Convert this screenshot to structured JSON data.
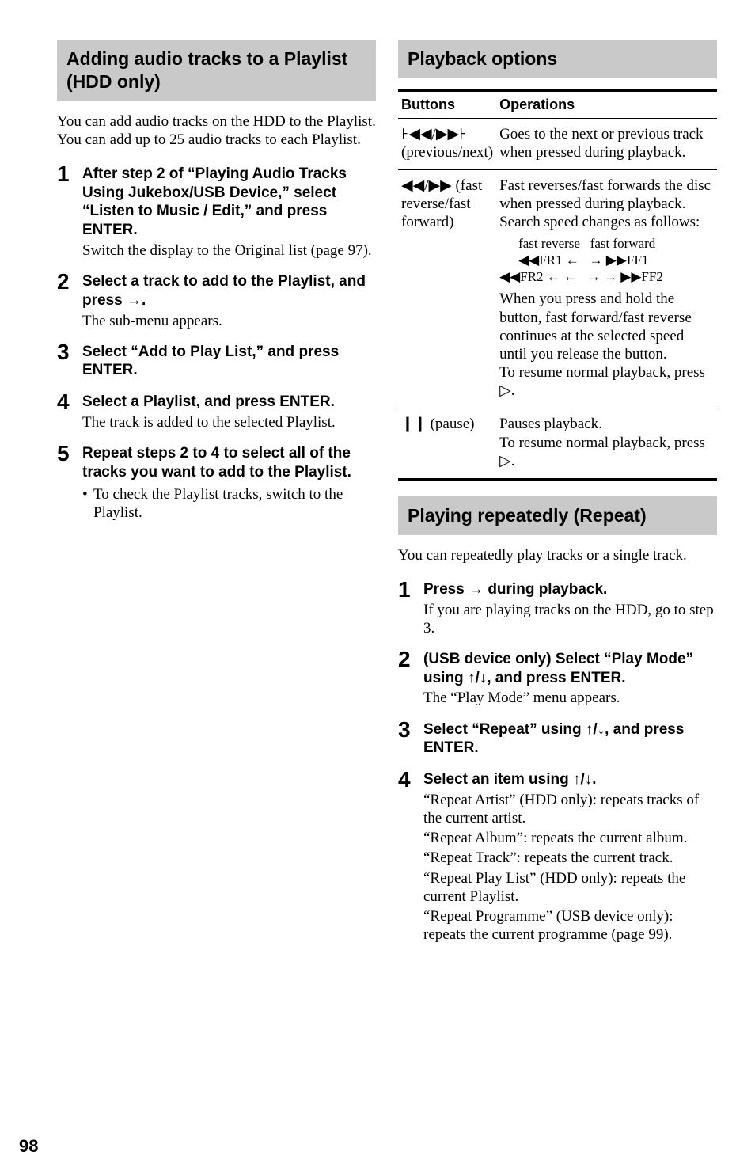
{
  "left": {
    "title": "Adding audio tracks to a Playlist (HDD only)",
    "intro": "You can add audio tracks on the HDD to the Playlist. You can add up to 25 audio tracks to each Playlist.",
    "steps": [
      {
        "num": "1",
        "head": "After step 2 of “Playing Audio Tracks Using Jukebox/USB Device,” select “Listen to Music / Edit,” and press ENTER.",
        "sub": "Switch the display to the Original list (page 97)."
      },
      {
        "num": "2",
        "head": "Select a track to add to the Playlist, and press →.",
        "sub": "The sub-menu appears."
      },
      {
        "num": "3",
        "head": "Select “Add to Play List,” and press ENTER."
      },
      {
        "num": "4",
        "head": "Select a Playlist, and press ENTER.",
        "sub": "The track is added to the selected Playlist."
      },
      {
        "num": "5",
        "head": "Repeat steps 2 to 4 to select all of the tracks you want to add to the Playlist.",
        "bullet": "To check the Playlist tracks, switch to the Playlist."
      }
    ]
  },
  "right": {
    "playback_title": "Playback options",
    "table": {
      "head_buttons": "Buttons",
      "head_ops": "Operations",
      "rows": [
        {
          "btn": "꜔◀◀/▶▶꜔ (previous/next)",
          "op": "Goes to the next or previous track when pressed during playback."
        },
        {
          "btn": "◀◀/▶▶ (fast reverse/fast forward)",
          "op_line1": "Fast reverses/fast forwards the disc when pressed during playback.",
          "op_line2": "Search speed changes as follows:",
          "speed_label": "fast reverse   fast forward",
          "speed_row1": "◀◀FR1 ←   → ▶▶FF1",
          "speed_row2": "◀◀FR2 ← ←   → → ▶▶FF2",
          "op_line3": "When you press and hold the button, fast forward/fast reverse continues at the selected speed until you release the button.",
          "op_line4": "To resume normal playback, press ▷."
        },
        {
          "btn": "❙❙ (pause)",
          "op_line1": "Pauses playback.",
          "op_line2": "To resume normal playback, press ▷."
        }
      ]
    },
    "repeat_title": "Playing repeatedly (Repeat)",
    "repeat_intro": "You can repeatedly play tracks or a single track.",
    "repeat_steps": [
      {
        "num": "1",
        "head": "Press → during playback.",
        "sub": "If you are playing tracks on the HDD, go to step 3."
      },
      {
        "num": "2",
        "head": "(USB device only) Select “Play Mode” using ↑/↓, and press ENTER.",
        "sub": "The “Play Mode” menu appears."
      },
      {
        "num": "3",
        "head": "Select “Repeat” using ↑/↓, and press ENTER."
      },
      {
        "num": "4",
        "head": "Select an item using ↑/↓.",
        "sub_multi": [
          "“Repeat Artist” (HDD only): repeats tracks of the current artist.",
          "“Repeat Album”: repeats the current album.",
          "“Repeat Track”: repeats the current track.",
          "“Repeat Play List” (HDD only): repeats the current Playlist.",
          "“Repeat Programme” (USB device only): repeats the current programme (page 99)."
        ]
      }
    ]
  },
  "page_number": "98"
}
